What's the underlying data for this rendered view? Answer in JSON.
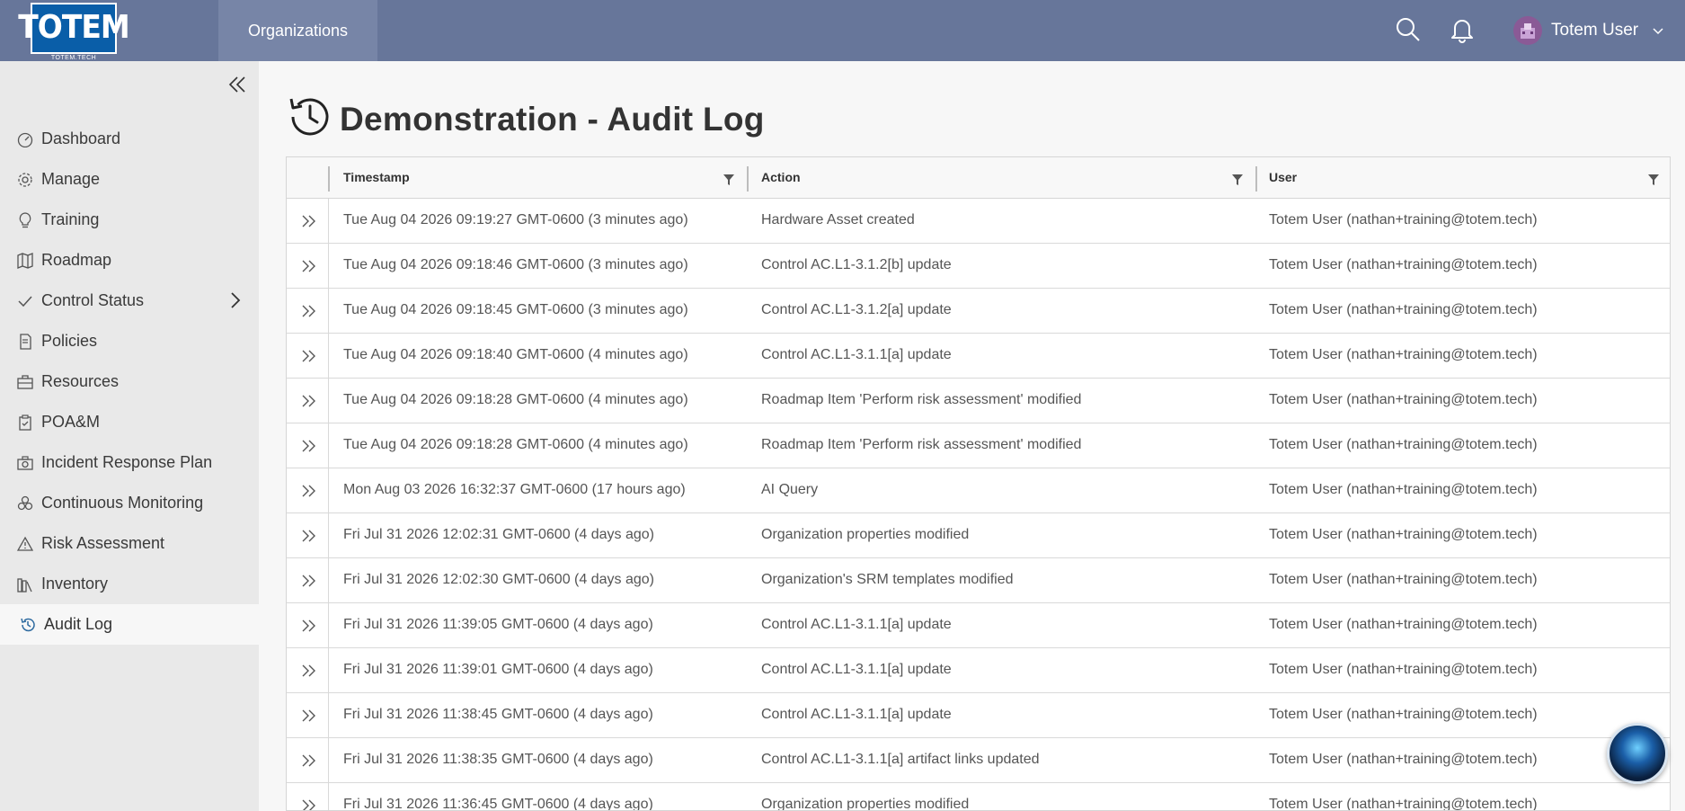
{
  "header": {
    "logo_text": "TOTEM",
    "logo_subtext": "TOTEM.TECH",
    "nav_tab": "Organizations",
    "user_name": "Totem User"
  },
  "sidebar": {
    "items": [
      {
        "label": "Dashboard",
        "icon": "dashboard-icon"
      },
      {
        "label": "Manage",
        "icon": "gear-icon"
      },
      {
        "label": "Training",
        "icon": "lightbulb-icon"
      },
      {
        "label": "Roadmap",
        "icon": "map-icon"
      },
      {
        "label": "Control Status",
        "icon": "check-icon"
      },
      {
        "label": "Policies",
        "icon": "document-icon"
      },
      {
        "label": "Resources",
        "icon": "briefcase-icon"
      },
      {
        "label": "POA&M",
        "icon": "clipboard-icon"
      },
      {
        "label": "Incident Response Plan",
        "icon": "camera-icon"
      },
      {
        "label": "Continuous Monitoring",
        "icon": "cycle-icon"
      },
      {
        "label": "Risk Assessment",
        "icon": "warning-icon"
      },
      {
        "label": "Inventory",
        "icon": "books-icon"
      },
      {
        "label": "Audit Log",
        "icon": "history-icon"
      }
    ]
  },
  "page": {
    "title": "Demonstration - Audit Log"
  },
  "table": {
    "columns": [
      "Timestamp",
      "Action",
      "User"
    ],
    "rows": [
      [
        "Tue Aug 04 2026 09:19:27 GMT-0600 (3 minutes ago)",
        "Hardware Asset created",
        "Totem User (nathan+training@totem.tech)"
      ],
      [
        "Tue Aug 04 2026 09:18:46 GMT-0600 (3 minutes ago)",
        "Control AC.L1-3.1.2[b] update",
        "Totem User (nathan+training@totem.tech)"
      ],
      [
        "Tue Aug 04 2026 09:18:45 GMT-0600 (3 minutes ago)",
        "Control AC.L1-3.1.2[a] update",
        "Totem User (nathan+training@totem.tech)"
      ],
      [
        "Tue Aug 04 2026 09:18:40 GMT-0600 (4 minutes ago)",
        "Control AC.L1-3.1.1[a] update",
        "Totem User (nathan+training@totem.tech)"
      ],
      [
        "Tue Aug 04 2026 09:18:28 GMT-0600 (4 minutes ago)",
        "Roadmap Item 'Perform risk assessment' modified",
        "Totem User (nathan+training@totem.tech)"
      ],
      [
        "Tue Aug 04 2026 09:18:28 GMT-0600 (4 minutes ago)",
        "Roadmap Item 'Perform risk assessment' modified",
        "Totem User (nathan+training@totem.tech)"
      ],
      [
        "Mon Aug 03 2026 16:32:37 GMT-0600 (17 hours ago)",
        "AI Query",
        "Totem User (nathan+training@totem.tech)"
      ],
      [
        "Fri Jul 31 2026 12:02:31 GMT-0600 (4 days ago)",
        "Organization properties modified",
        "Totem User (nathan+training@totem.tech)"
      ],
      [
        "Fri Jul 31 2026 12:02:30 GMT-0600 (4 days ago)",
        "Organization's SRM templates modified",
        "Totem User (nathan+training@totem.tech)"
      ],
      [
        "Fri Jul 31 2026 11:39:05 GMT-0600 (4 days ago)",
        "Control AC.L1-3.1.1[a] update",
        "Totem User (nathan+training@totem.tech)"
      ],
      [
        "Fri Jul 31 2026 11:39:01 GMT-0600 (4 days ago)",
        "Control AC.L1-3.1.1[a] update",
        "Totem User (nathan+training@totem.tech)"
      ],
      [
        "Fri Jul 31 2026 11:38:45 GMT-0600 (4 days ago)",
        "Control AC.L1-3.1.1[a] update",
        "Totem User (nathan+training@totem.tech)"
      ],
      [
        "Fri Jul 31 2026 11:38:35 GMT-0600 (4 days ago)",
        "Control AC.L1-3.1.1[a] artifact links updated",
        "Totem User (nathan+training@totem.tech)"
      ],
      [
        "Fri Jul 31 2026 11:36:45 GMT-0600 (4 days ago)",
        "Organization properties modified",
        "Totem User (nathan+training@totem.tech)"
      ]
    ]
  },
  "colors": {
    "header_bg": "#67769a",
    "nav_tab_bg": "#7785a7",
    "sidebar_bg": "#e9e9e9",
    "active_item_bg": "#f7f7f7",
    "logo_bg": "#0a5ea8"
  }
}
